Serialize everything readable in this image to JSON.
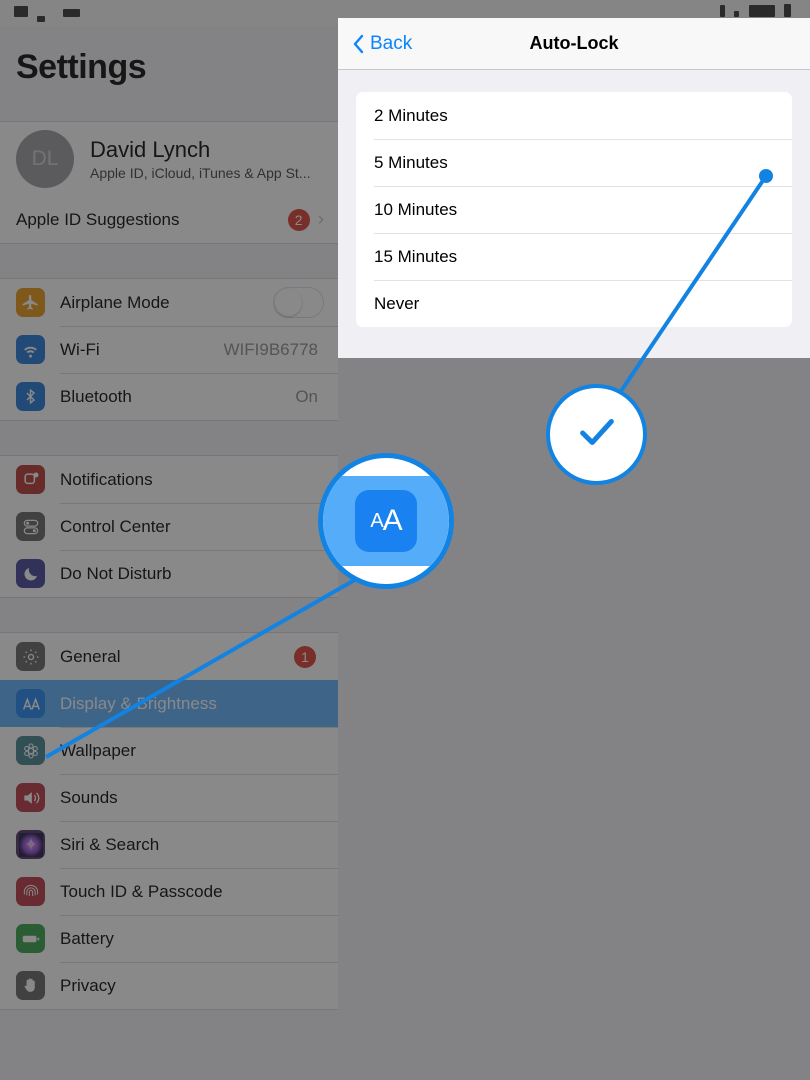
{
  "statusbar": {
    "left_redacted": true,
    "right_redacted": true
  },
  "sidebar": {
    "title": "Settings",
    "profile": {
      "initials": "DL",
      "name": "David Lynch",
      "subtitle": "Apple ID, iCloud, iTunes & App St..."
    },
    "suggestions": {
      "label": "Apple ID Suggestions",
      "badge": "2",
      "chevron": "›"
    },
    "group_connectivity": [
      {
        "label": "Airplane Mode",
        "icon": "airplane-icon",
        "color": "#e8960f",
        "control": "toggle",
        "toggle_on": false
      },
      {
        "label": "Wi-Fi",
        "icon": "wifi-icon",
        "color": "#1a73d6",
        "value": "WIFI9B6778"
      },
      {
        "label": "Bluetooth",
        "icon": "bluetooth-icon",
        "color": "#1a73d6",
        "value": "On"
      }
    ],
    "group_alerts": [
      {
        "label": "Notifications",
        "icon": "notifications-icon",
        "color": "#b3302c"
      },
      {
        "label": "Control Center",
        "icon": "control-center-icon",
        "color": "#5f5f63"
      },
      {
        "label": "Do Not Disturb",
        "icon": "moon-icon",
        "color": "#3d3d96"
      }
    ],
    "group_system": [
      {
        "label": "General",
        "icon": "gear-icon",
        "color": "#5f5f63",
        "badge": "1"
      },
      {
        "label": "Display & Brightness",
        "icon": "display-brightness-icon",
        "color": "#1a82f0",
        "selected": true
      },
      {
        "label": "Wallpaper",
        "icon": "wallpaper-icon",
        "color": "#3e7f8c"
      },
      {
        "label": "Sounds",
        "icon": "sounds-icon",
        "color": "#b3303c"
      },
      {
        "label": "Siri & Search",
        "icon": "siri-icon",
        "color": "#4b2a63"
      },
      {
        "label": "Touch ID & Passcode",
        "icon": "touch-id-icon",
        "color": "#b3303c"
      },
      {
        "label": "Battery",
        "icon": "battery-icon",
        "color": "#2f9e44"
      },
      {
        "label": "Privacy",
        "icon": "privacy-hand-icon",
        "color": "#5f5f63"
      }
    ]
  },
  "panel": {
    "back_label": "Back",
    "title": "Auto-Lock",
    "options": [
      {
        "label": "2 Minutes"
      },
      {
        "label": "5 Minutes"
      },
      {
        "label": "10 Minutes"
      },
      {
        "label": "15 Minutes"
      },
      {
        "label": "Never"
      }
    ]
  },
  "callouts": {
    "accent_color": "#1283e2",
    "aa_bubble": {
      "icon": "display-brightness-icon",
      "small_a": "A",
      "big_a": "A"
    },
    "check_bubble": {
      "icon": "checkmark-icon"
    }
  }
}
